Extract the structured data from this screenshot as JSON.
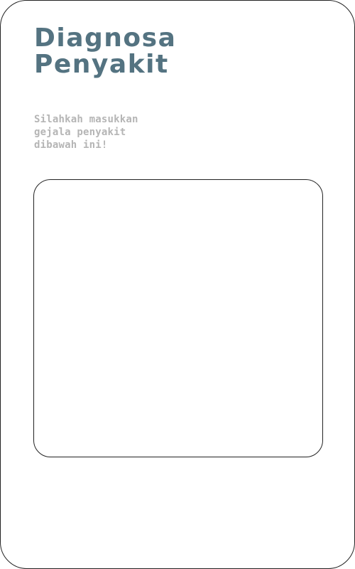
{
  "header": {
    "title_line1": "Diagnosa",
    "title_line2": "Penyakit"
  },
  "instructions": {
    "line1": "Silahkah masukkan",
    "line2": "gejala penyakit",
    "line3": "dibawah ini!"
  },
  "symptom_input": {
    "value": "",
    "placeholder": ""
  },
  "colors": {
    "title": "#547381",
    "subtitle": "#b5b5b5",
    "border": "#222222",
    "background": "#ffffff"
  }
}
